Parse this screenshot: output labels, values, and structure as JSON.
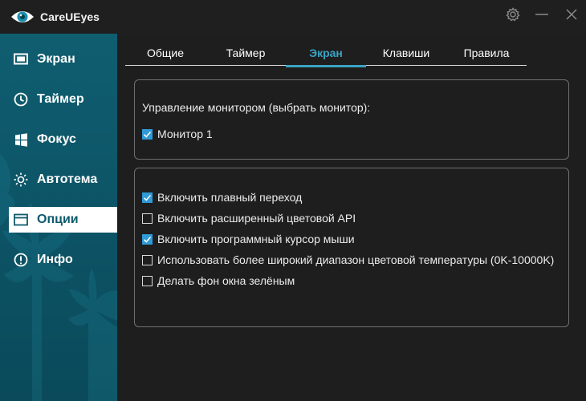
{
  "window": {
    "title": "CareUEyes",
    "icons": [
      "eye-logo-icon",
      "gear-icon",
      "minimize-icon",
      "close-icon"
    ]
  },
  "sidebar": {
    "items": [
      {
        "label": "Экран",
        "icon": "monitor-icon",
        "active": false
      },
      {
        "label": "Таймер",
        "icon": "clock-icon",
        "active": false
      },
      {
        "label": "Фокус",
        "icon": "windows-icon",
        "active": false
      },
      {
        "label": "Автотема",
        "icon": "sun-icon",
        "active": false
      },
      {
        "label": "Опции",
        "icon": "folder-icon",
        "active": true
      },
      {
        "label": "Инфо",
        "icon": "info-icon",
        "active": false
      }
    ]
  },
  "tabs": [
    {
      "label": "Общие",
      "active": false
    },
    {
      "label": "Таймер",
      "active": false
    },
    {
      "label": "Экран",
      "active": true
    },
    {
      "label": "Клавиши",
      "active": false
    },
    {
      "label": "Правила",
      "active": false
    }
  ],
  "monitor_panel": {
    "heading": "Управление монитором (выбрать монитор):",
    "monitors": [
      {
        "label": "Монитор 1",
        "checked": true
      }
    ]
  },
  "options_panel": {
    "options": [
      {
        "label": "Включить плавный переход",
        "checked": true
      },
      {
        "label": "Включить расширенный цветовой API",
        "checked": false
      },
      {
        "label": "Включить программный курсор мыши",
        "checked": true
      },
      {
        "label": "Использовать более широкий диапазон цветовой температуры (0K-10000K)",
        "checked": false
      },
      {
        "label": "Делать фон окна зелёным",
        "checked": false
      }
    ]
  },
  "colors": {
    "accent": "#3aa3c4",
    "checkbox": "#2f9ad6",
    "sidebar": "#0c5365",
    "background": "#1e1e1e"
  }
}
